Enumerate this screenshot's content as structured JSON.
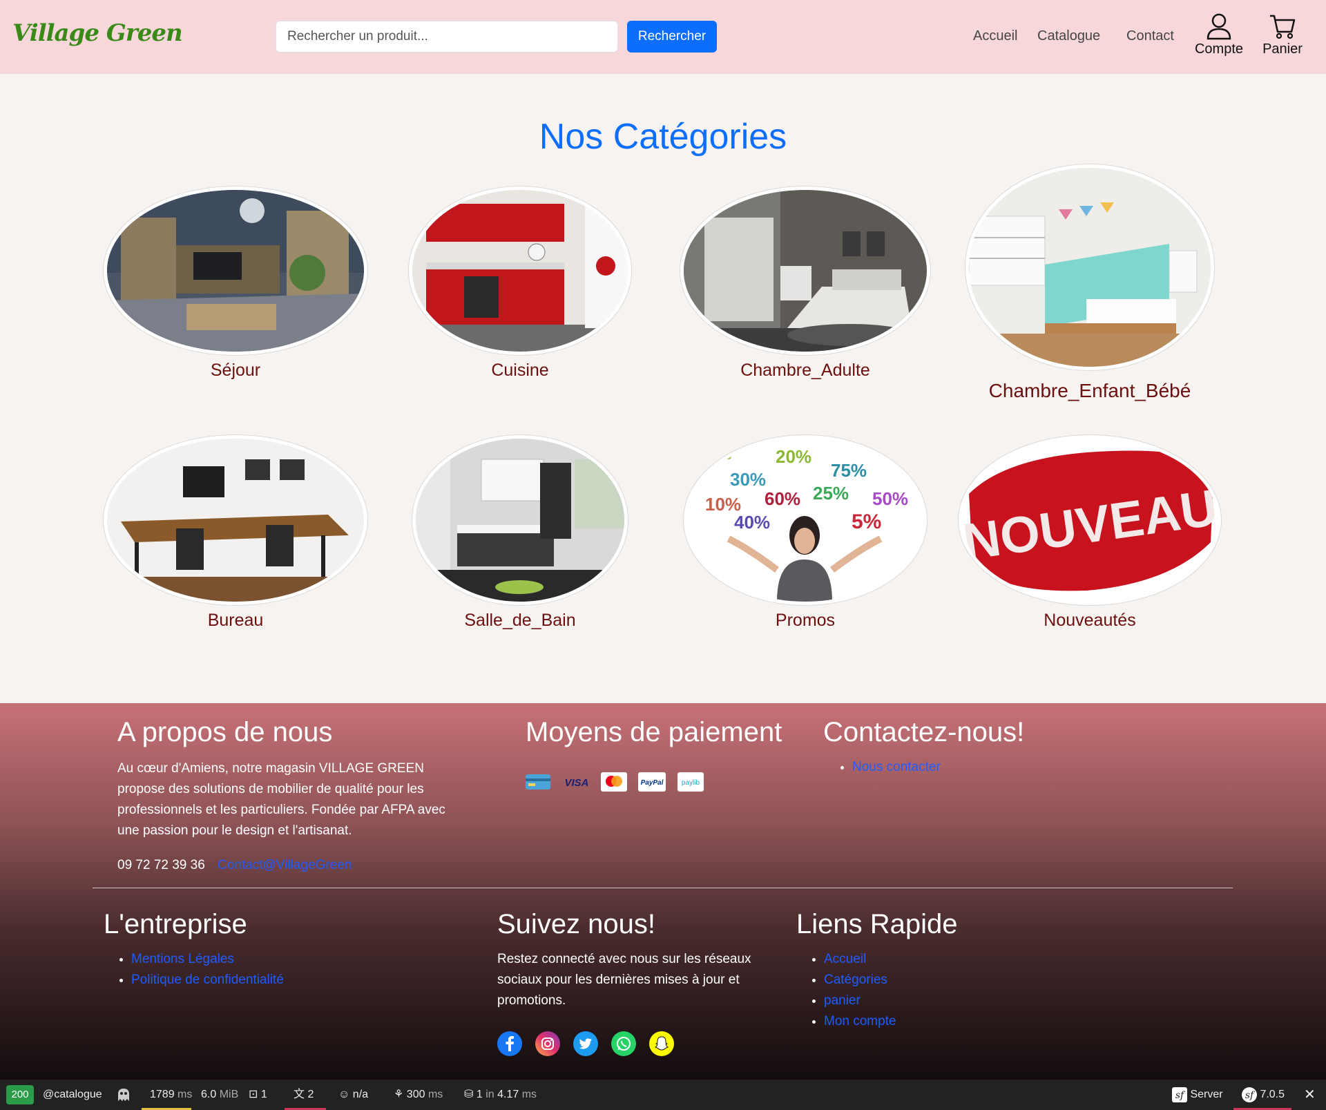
{
  "nav": {
    "logo": "Village Green",
    "search_placeholder": "Rechercher un produit...",
    "search_button": "Rechercher",
    "links": [
      "Accueil",
      "Catalogue",
      "Contact"
    ],
    "account_label": "Compte",
    "cart_label": "Panier"
  },
  "main": {
    "heading": "Nos Catégories",
    "categories": [
      "Séjour",
      "Cuisine",
      "Chambre_Adulte",
      "Chambre_Enfant_Bébé",
      "Bureau",
      "Salle_de_Bain",
      "Promos",
      "Nouveautés"
    ],
    "promo_percentages": [
      "%",
      "20%",
      "75%",
      "30%",
      "60%",
      "25%",
      "50%",
      "10%",
      "40%",
      "5%"
    ],
    "nouveau_text": "NOUVEAU"
  },
  "footer": {
    "about_title": "A propos de nous",
    "about_text": "Au cœur d'Amiens, notre magasin VILLAGE GREEN propose des solutions de mobilier de qualité pour les professionnels et les particuliers. Fondée par AFPA avec une passion pour le design et l'artisanat.",
    "phone": "09 72 72 39 36",
    "email_link": "Contact@VillageGreen",
    "payment_title": "Moyens de paiement",
    "payment_methods": [
      "card-icon",
      "visa-icon",
      "mastercard-icon",
      "paypal-icon",
      "paylib-icon"
    ],
    "payment_labels": [
      "VISA",
      "PayPal",
      "paylib"
    ],
    "contact_title": "Contactez-nous!",
    "contact_link": "Nous contacter",
    "company_title": "L'entreprise",
    "company_links": [
      "Mentions Légales",
      "Politique de confidentialité"
    ],
    "follow_title": "Suivez nous!",
    "follow_text": "Restez connecté avec nous sur les réseaux sociaux pour les dernières mises à jour et promotions.",
    "social_icons": [
      "facebook-icon",
      "instagram-icon",
      "twitter-icon",
      "whatsapp-icon",
      "snapchat-icon"
    ],
    "quick_title": "Liens Rapide",
    "quick_links": [
      "Accueil",
      "Catégories",
      "panier",
      "Mon compte"
    ]
  },
  "toolbar": {
    "status": "200",
    "route": "@catalogue",
    "time": "1789",
    "time_unit": "ms",
    "memory": "6.0",
    "memory_unit": "MiB",
    "forms": "1",
    "translations": "2",
    "user": "n/a",
    "perf": "300",
    "perf_unit": "ms",
    "db": "1",
    "db_in": "in",
    "db_time": "4.17",
    "db_unit": "ms",
    "server": "Server",
    "version": "7.0.5"
  },
  "colors": {
    "navbar": "#f8d7da",
    "heading": "#0d6efd",
    "category_label": "#6b0f0f",
    "logo": "#3a8a1a"
  }
}
